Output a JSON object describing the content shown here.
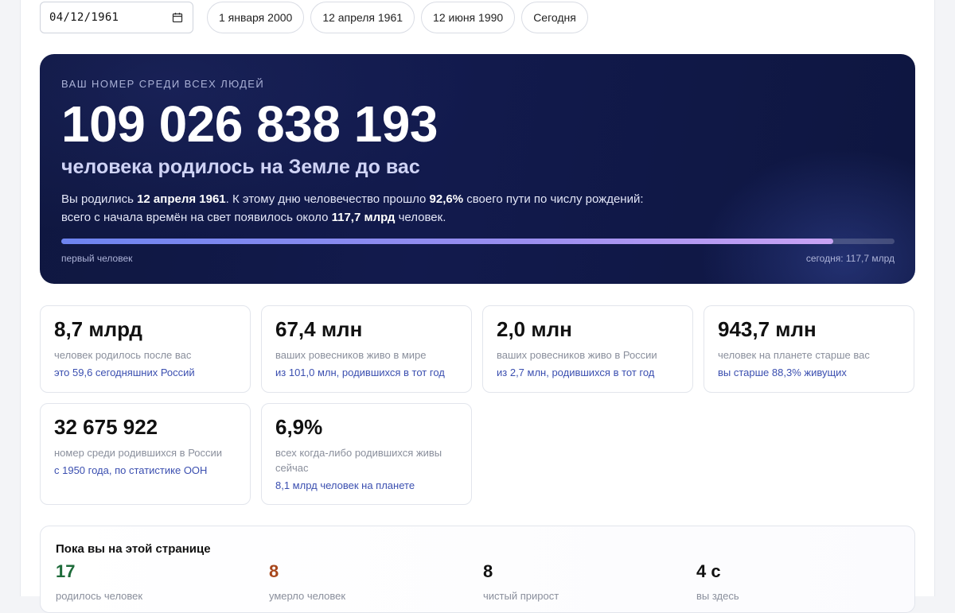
{
  "controls": {
    "date_value": "04/12/1961",
    "chips": [
      "1 января 2000",
      "12 апреля 1961",
      "12 июня 1990",
      "Сегодня"
    ]
  },
  "hero": {
    "kicker": "ВАШ НОМЕР СРЕДИ ВСЕХ ЛЮДЕЙ",
    "number": "109 026 838 193",
    "subtitle": "человека родилось на Земле до вас",
    "desc": {
      "p1": "Вы родились ",
      "date": "12 апреля 1961",
      "p2": ". К этому дню человечество прошло ",
      "percent": "92,6%",
      "p3": " своего пути по числу рождений:",
      "p4": "всего с начала времён на свет появилось около ",
      "total": "117,7 млрд",
      "p5": " человек."
    },
    "progress": 0.926,
    "bar_left": "первый человек",
    "bar_right": "сегодня: 117,7 млрд"
  },
  "stats": [
    {
      "num": "8,7 млрд",
      "label": "человек родилось после вас",
      "note": "это 59,6 сегодняшних Россий"
    },
    {
      "num": "67,4 млн",
      "label": "ваших ровесников живо в мире",
      "note": "из 101,0 млн, родившихся в тот год"
    },
    {
      "num": "2,0 млн",
      "label": "ваших ровесников живо в России",
      "note": "из 2,7 млн, родившихся в тот год"
    },
    {
      "num": "943,7 млн",
      "label": "человек на планете старше вас",
      "note": "вы старше 88,3% живущих"
    },
    {
      "num": "32 675 922",
      "label": "номер среди родившихся в России",
      "note": "с 1950 года, по статистике ООН"
    },
    {
      "num": "6,9%",
      "label": "всех когда-либо родившихся живы сейчас",
      "note": "8,1 млрд человек на планете"
    }
  ],
  "live": {
    "title": "Пока вы на этой странице",
    "cells": [
      {
        "value": "17",
        "label": "родилось человек",
        "color": "#1e6b3a"
      },
      {
        "value": "8",
        "label": "умерло человек",
        "color": "#a8471c"
      },
      {
        "value": "8",
        "label": "чистый прирост",
        "color": "#111111"
      },
      {
        "value": "4 с",
        "label": "вы здесь",
        "color": "#111111"
      }
    ]
  },
  "colors": {
    "accent_link": "#3b4fb0",
    "hero_bg": "#121a4d",
    "born_green": "#1e6b3a",
    "died_orange": "#a8471c"
  }
}
